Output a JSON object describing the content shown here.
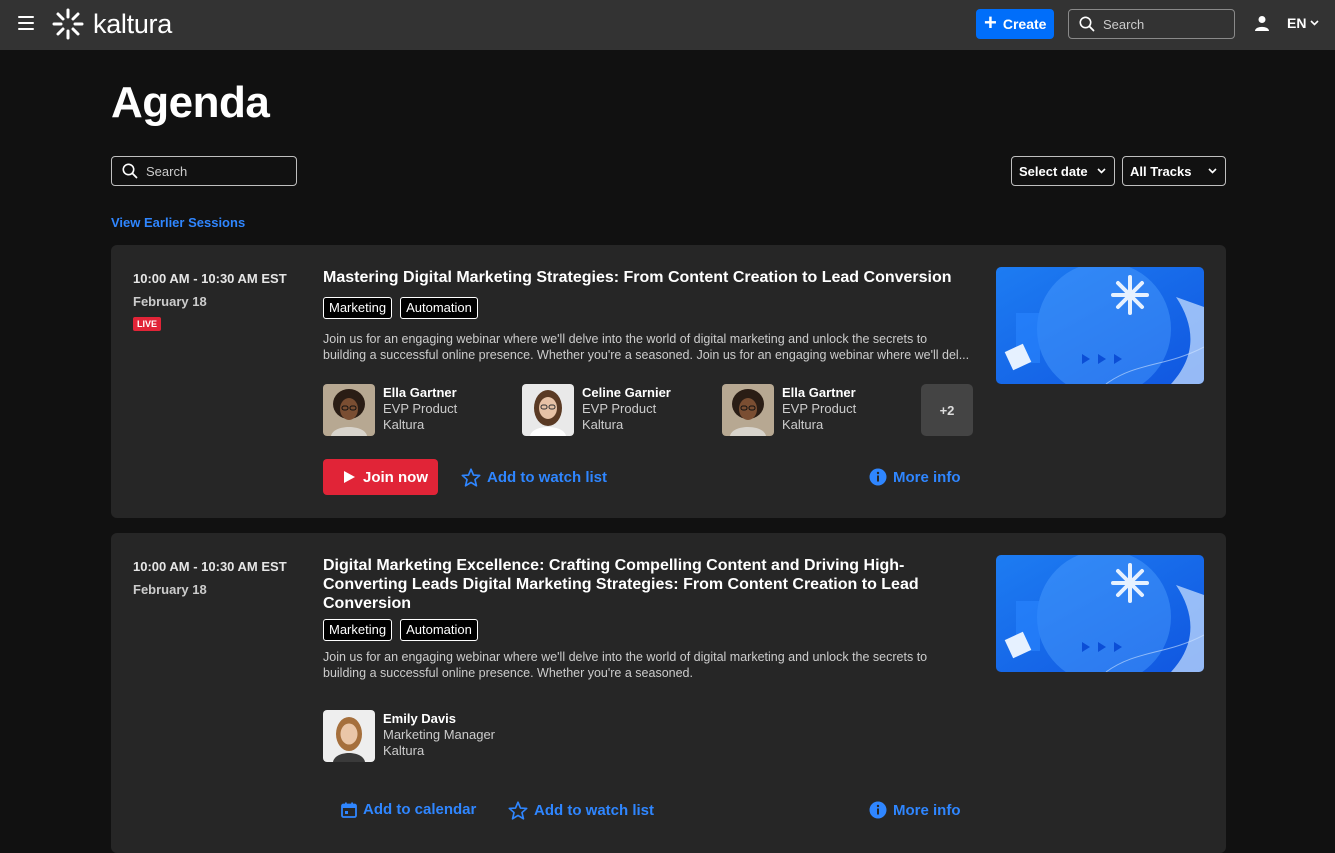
{
  "header": {
    "logo_text": "kaltura",
    "create_label": "Create",
    "search_placeholder": "Search",
    "language": "EN"
  },
  "page": {
    "title": "Agenda",
    "search_placeholder": "Search",
    "date_filter": "Select date",
    "track_filter": "All Tracks",
    "earlier_sessions": "View Earlier Sessions"
  },
  "sessions": [
    {
      "time": "10:00 AM - 10:30 AM EST",
      "date": "February 18",
      "live_badge": "LIVE",
      "title": "Mastering Digital Marketing Strategies: From Content Creation to Lead Conversion",
      "tags": [
        "Marketing",
        "Automation"
      ],
      "description_line1": "Join us for an engaging webinar where we'll delve into the world of digital marketing and unlock the secrets to",
      "description_line2": "building a successful online presence. Whether you're a seasoned. Join us for an engaging webinar where we'll del...",
      "speakers": [
        {
          "name": "Ella Gartner",
          "role": "EVP Product",
          "org": "Kaltura"
        },
        {
          "name": "Celine Garnier",
          "role": "EVP Product",
          "org": "Kaltura"
        },
        {
          "name": "Ella Gartner",
          "role": "EVP Product",
          "org": "Kaltura"
        }
      ],
      "more_speakers": "+2",
      "primary_action": "Join now",
      "watchlist_action": "Add to watch list",
      "info_action": "More info"
    },
    {
      "time": "10:00 AM - 10:30 AM EST",
      "date": "February 18",
      "title": "Digital Marketing Excellence: Crafting Compelling Content and Driving High-Converting Leads Digital Marketing Strategies: From Content Creation to Lead Conversion",
      "tags": [
        "Marketing",
        "Automation"
      ],
      "description_line1": "Join us for an engaging webinar where we'll delve into the world of digital marketing and unlock the secrets to",
      "description_line2": "building a successful online presence. Whether you're a seasoned.",
      "speakers": [
        {
          "name": "Emily Davis",
          "role": "Marketing Manager",
          "org": "Kaltura"
        }
      ],
      "calendar_action": "Add to calendar",
      "watchlist_action": "Add to watch list",
      "info_action": "More info"
    }
  ],
  "icons": {
    "menu": "hamburger-menu-icon",
    "logo": "kaltura-asterisk-icon",
    "search": "search-icon",
    "user": "user-icon",
    "chevron": "chevron-down-icon",
    "play": "play-icon",
    "star": "star-outline-icon",
    "info": "info-circle-icon",
    "calendar": "calendar-icon"
  },
  "colors": {
    "background": "#111111",
    "topbar": "#333333",
    "card": "#262626",
    "accent_blue": "#006efa",
    "link_blue": "#2f86ff",
    "live_red": "#e12437"
  }
}
